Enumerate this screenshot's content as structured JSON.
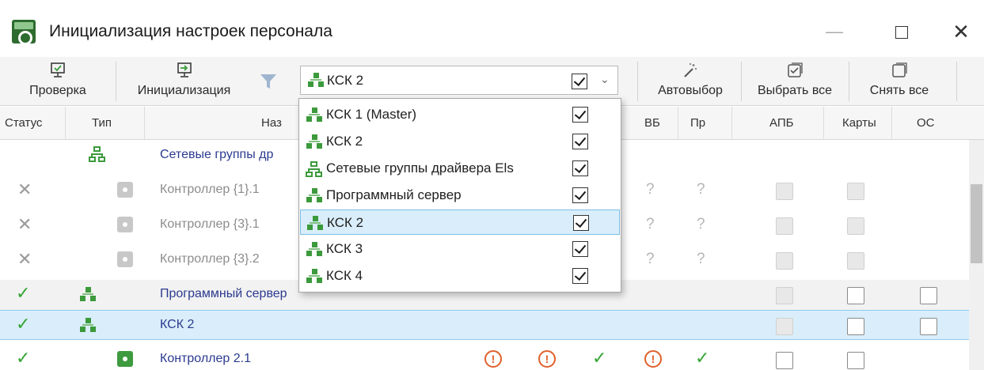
{
  "window": {
    "title": "Инициализация настроек персонала",
    "minimize": "—",
    "close": "✕"
  },
  "toolbar": {
    "check_label": "Проверка",
    "init_label": "Инициализация",
    "combo_value": "КСК 2",
    "autoselect_label": "Автовыбор",
    "select_all_label": "Выбрать все",
    "deselect_all_label": "Снять все"
  },
  "dropdown": {
    "items": [
      {
        "label": "КСК 1 (Master)",
        "icon": "server-icon",
        "checked": true
      },
      {
        "label": "КСК 2",
        "icon": "server-icon",
        "checked": true
      },
      {
        "label": "Сетевые группы драйвера Els",
        "icon": "network-group-icon",
        "checked": true
      },
      {
        "label": "Программный сервер",
        "icon": "server-icon",
        "checked": true
      },
      {
        "label": "КСК 2",
        "icon": "server-icon",
        "checked": true,
        "highlighted": true
      },
      {
        "label": "КСК 3",
        "icon": "server-icon",
        "checked": true
      },
      {
        "label": "КСК 4",
        "icon": "server-icon",
        "checked": true
      }
    ]
  },
  "grid": {
    "columns": {
      "status": "Статус",
      "type": "Тип",
      "name": "Наз",
      "vb": "ВБ",
      "pr": "Пр",
      "apb": "АПБ",
      "cards": "Карты",
      "os": "ОС"
    },
    "rows": [
      {
        "name": "Сетевые группы др",
        "kind": "network-group"
      },
      {
        "name": "Контроллер {1}.1",
        "kind": "controller",
        "status": "error"
      },
      {
        "name": "Контроллер {3}.1",
        "kind": "controller",
        "status": "error"
      },
      {
        "name": "Контроллер {3}.2",
        "kind": "controller",
        "status": "error"
      },
      {
        "name": "Программный сервер",
        "kind": "server",
        "status": "ok"
      },
      {
        "name": "КСК 2",
        "kind": "server",
        "status": "ok",
        "selected": true
      },
      {
        "name": "Контроллер 2.1",
        "kind": "controller",
        "status": "ok"
      }
    ],
    "unknown_mark": "?",
    "warning_mark": "!"
  },
  "colors": {
    "accent_green": "#3c9a3c",
    "selection": "#d9eefa",
    "warning": "#e0602a",
    "link_text": "#2b3a8f"
  }
}
